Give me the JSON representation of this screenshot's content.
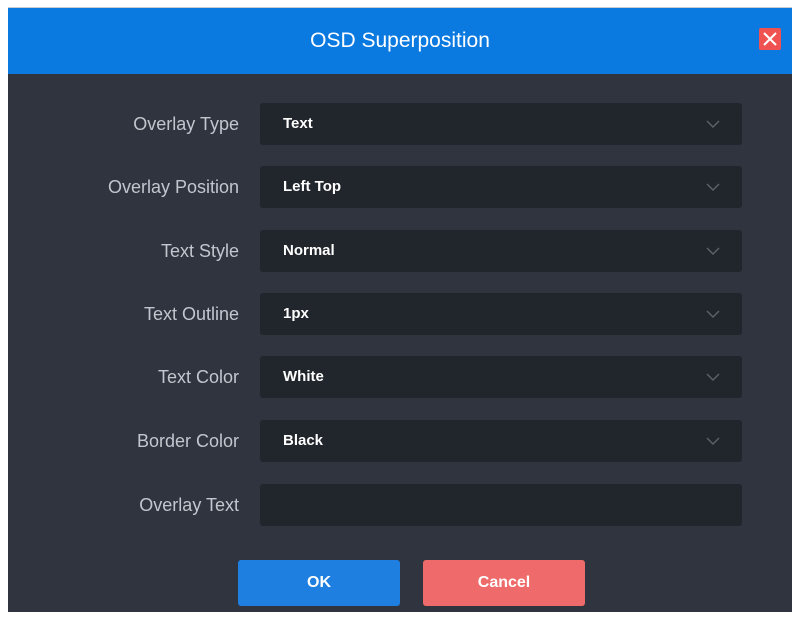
{
  "dialog": {
    "title": "OSD Superposition",
    "close_icon": "close-icon"
  },
  "fields": {
    "overlay_type": {
      "label": "Overlay Type",
      "value": "Text"
    },
    "overlay_position": {
      "label": "Overlay Position",
      "value": "Left Top"
    },
    "text_style": {
      "label": "Text Style",
      "value": "Normal"
    },
    "text_outline": {
      "label": "Text Outline",
      "value": "1px"
    },
    "text_color": {
      "label": "Text Color",
      "value": "White"
    },
    "border_color": {
      "label": "Border Color",
      "value": "Black"
    },
    "overlay_text": {
      "label": "Overlay Text",
      "value": ""
    }
  },
  "buttons": {
    "ok_label": "OK",
    "cancel_label": "Cancel"
  },
  "icons": {
    "dropdown": "chevron-down-icon"
  },
  "colors": {
    "title_bar": "#0a79e0",
    "dialog_bg": "#2f343e",
    "input_bg": "#21252c",
    "ok_button": "#1e7fe0",
    "cancel_button": "#ef6a6a",
    "close_button": "#f05252"
  }
}
